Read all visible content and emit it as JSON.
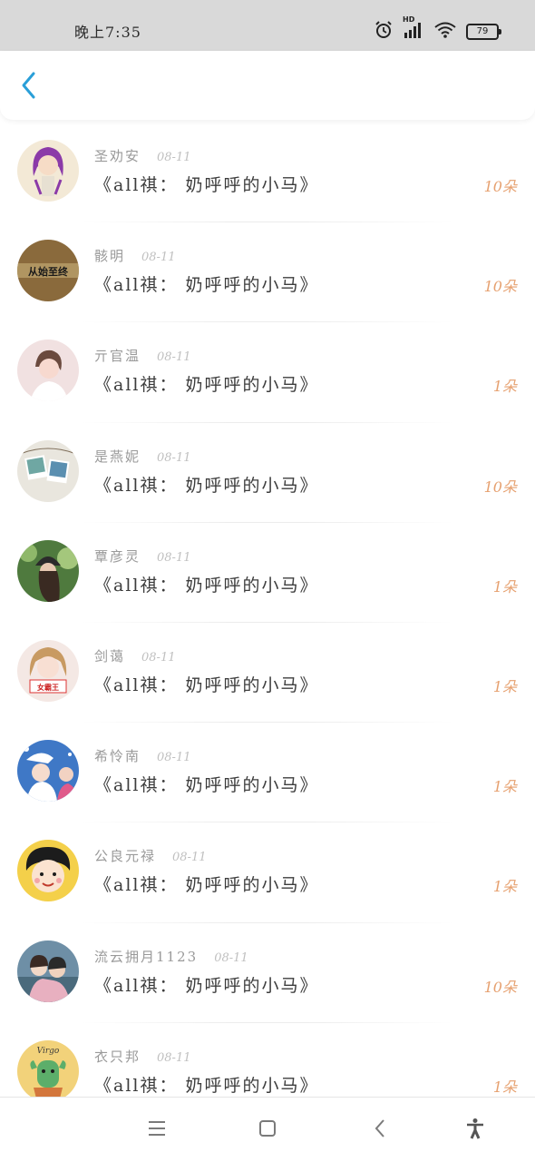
{
  "status_bar": {
    "time": "晚上7:35",
    "battery": "79",
    "signal_label": "HD"
  },
  "header": {
    "back_icon": "chevron-left-icon",
    "accent_color": "#2a9fd8"
  },
  "list": {
    "items": [
      {
        "name": "圣劝安",
        "date": "08-11",
        "title": "《all祺： 奶呼呼的小马》",
        "count": "10朵",
        "avatar": "purple-hair-girl"
      },
      {
        "name": "骸明",
        "date": "08-11",
        "title": "《all祺： 奶呼呼的小马》",
        "count": "10朵",
        "avatar": "text-avatar"
      },
      {
        "name": "亓官温",
        "date": "08-11",
        "title": "《all祺： 奶呼呼的小马》",
        "count": "1朵",
        "avatar": "portrait-pink"
      },
      {
        "name": "是燕妮",
        "date": "08-11",
        "title": "《all祺： 奶呼呼的小马》",
        "count": "10朵",
        "avatar": "photo-cards"
      },
      {
        "name": "覃彦灵",
        "date": "08-11",
        "title": "《all祺： 奶呼呼的小马》",
        "count": "1朵",
        "avatar": "girl-green"
      },
      {
        "name": "剑蔼",
        "date": "08-11",
        "title": "《all祺： 奶呼呼的小马》",
        "count": "1朵",
        "avatar": "girl-sign"
      },
      {
        "name": "希怜南",
        "date": "08-11",
        "title": "《all祺： 奶呼呼的小马》",
        "count": "1朵",
        "avatar": "blue-idols"
      },
      {
        "name": "公良元禄",
        "date": "08-11",
        "title": "《all祺： 奶呼呼的小马》",
        "count": "1朵",
        "avatar": "maruko-cartoon"
      },
      {
        "name": "流云拥月1123",
        "date": "08-11",
        "title": "《all祺： 奶呼呼的小马》",
        "count": "10朵",
        "avatar": "couple-anime"
      },
      {
        "name": "衣只邦",
        "date": "08-11",
        "title": "《all祺： 奶呼呼的小马》",
        "count": "1朵",
        "avatar": "virgo-cactus"
      }
    ],
    "avatar_text": "从始至终",
    "sign_text": "女霸王",
    "virgo_text": "Virgo"
  },
  "colors": {
    "count": "#e6a06f",
    "name": "#9a9a9a",
    "title": "#3c3c3c",
    "status_bar_bg": "#d9d9d9"
  },
  "nav_bar": {
    "buttons": [
      "menu-icon",
      "home-square-icon",
      "back-chevron-icon",
      "accessibility-icon"
    ]
  }
}
